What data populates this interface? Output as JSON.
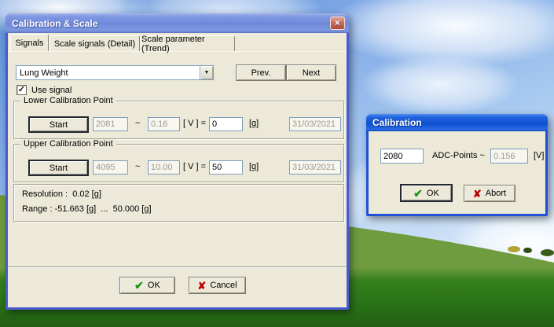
{
  "icons": {
    "close": "×",
    "dropdown": "▼",
    "check": "✔",
    "cross": "✘",
    "checkbox_check": "✓"
  },
  "colors": {
    "dialog_bg": "#ece9d8",
    "titlebar_active": "#0d50d0",
    "titlebar_inactive": "#7089da",
    "field_border": "#7f9db9",
    "ok_check_green": "#149614",
    "cancel_cross_red": "#b80000",
    "grass_green": "#2e7c1c",
    "sky_blue": "#7fa9e6"
  },
  "main_dialog": {
    "title": "Calibration & Scale",
    "tabs": [
      {
        "label": "Signals",
        "active": true
      },
      {
        "label": "Scale signals (Detail)",
        "active": false
      },
      {
        "label": "Scale parameter (Trend)",
        "active": false
      }
    ],
    "signal_select": {
      "value": "Lung Weight"
    },
    "prev_label": "Prev.",
    "next_label": "Next",
    "use_signal_label": "Use signal",
    "use_signal_checked": true,
    "lower": {
      "title": "Lower Calibration Point",
      "start_label": "Start",
      "adc": "2081",
      "tilde": "~",
      "volt": "0.16",
      "v_eq_label": "[ V ] =",
      "value": "0",
      "unit_label": "[g]",
      "date": "31/03/2021"
    },
    "upper": {
      "title": "Upper Calibration Point",
      "start_label": "Start",
      "adc": "4095",
      "tilde": "~",
      "volt": "10.00",
      "v_eq_label": "[ V ] =",
      "value": "50",
      "unit_label": "[g]",
      "date": "31/03/2021"
    },
    "info": {
      "resolution": "Resolution :  0.02 [g]",
      "range": "Range : -51.663 [g]  ...  50.000 [g]"
    },
    "ok_label": "OK",
    "cancel_label": "Cancel"
  },
  "calibration_dialog": {
    "title": "Calibration",
    "adc_value": "2080",
    "adc_label": "ADC-Points ~",
    "volt_value": "0.156",
    "volt_unit": "[V]",
    "ok_label": "OK",
    "abort_label": "Abort"
  }
}
